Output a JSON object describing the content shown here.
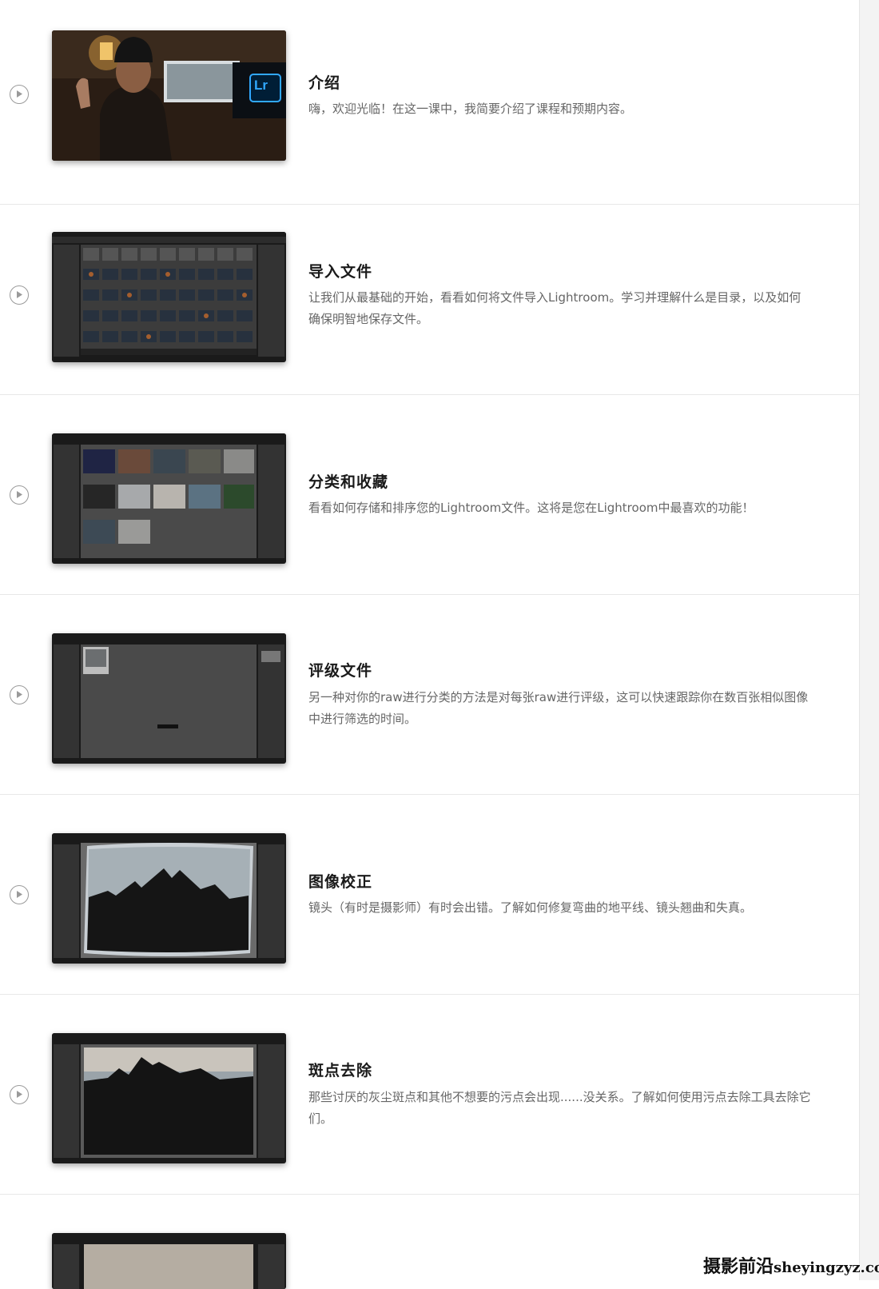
{
  "lessons": [
    {
      "title": "介绍",
      "description": "嗨，欢迎光临！在这一课中，我简要介绍了课程和预期内容。",
      "thumbnail": "presenter-video",
      "logo_text": "Lr"
    },
    {
      "title": "导入文件",
      "description": "让我们从最基础的开始，看看如何将文件导入Lightroom。学习并理解什么是目录，以及如何确保明智地保存文件。",
      "thumbnail": "lightroom-grid-import"
    },
    {
      "title": "分类和收藏",
      "description": "看看如何存储和排序您的Lightroom文件。这将是您在Lightroom中最喜欢的功能！",
      "thumbnail": "lightroom-collection-grid"
    },
    {
      "title": "评级文件",
      "description": "另一种对你的raw进行分类的方法是对每张raw进行评级，这可以快速跟踪你在数百张相似图像中进行筛选的时间。",
      "thumbnail": "lightroom-rating"
    },
    {
      "title": "图像校正",
      "description": "镜头（有时是摄影师）有时会出错。了解如何修复弯曲的地平线、镜头翘曲和失真。",
      "thumbnail": "lightroom-lens-correction"
    },
    {
      "title": "斑点去除",
      "description": "那些讨厌的灰尘斑点和其他不想要的污点会出现......没关系。了解如何使用污点去除工具去除它们。",
      "thumbnail": "lightroom-spot-removal"
    },
    {
      "title": "",
      "description": "",
      "thumbnail": "lightroom-develop-partial"
    }
  ],
  "icons": {
    "play": "play-circle-icon"
  },
  "watermark": {
    "cn": "摄影前沿",
    "domain": "sheyingzyz.com"
  },
  "colors": {
    "title": "#1a1a1a",
    "description": "#666666",
    "divider": "#e8e8e8",
    "lr_blue": "#31a8ff"
  }
}
